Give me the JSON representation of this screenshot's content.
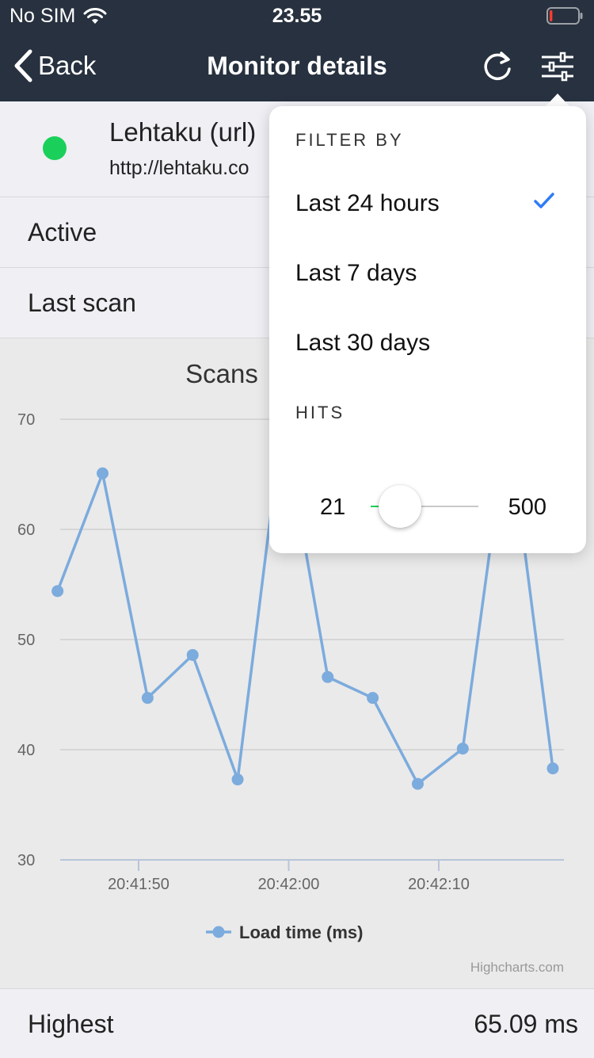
{
  "status_bar": {
    "carrier": "No SIM",
    "time": "23.55",
    "battery_level": 0.1
  },
  "nav": {
    "back_label": "Back",
    "title": "Monitor details",
    "refresh_icon": "refresh-icon",
    "filter_icon": "sliders-icon"
  },
  "monitor": {
    "name": "Lehtaku (url)",
    "url": "http://lehtaku.co",
    "status_color": "#1bd05a"
  },
  "rows": {
    "active_label": "Active",
    "last_scan_label": "Last scan"
  },
  "chart_data": {
    "type": "line",
    "title": "Scans",
    "x_ticks": [
      "20:41:50",
      "20:42:00",
      "20:42:10"
    ],
    "y_ticks": [
      30,
      40,
      50,
      60,
      70
    ],
    "ylim": [
      30,
      70
    ],
    "grid": true,
    "legend": "bottom",
    "color": "#7cabdd",
    "series": [
      {
        "name": "Load time (ms)",
        "x": [
          "20:41:44.6",
          "20:41:47.6",
          "20:41:50.6",
          "20:41:53.6",
          "20:41:56.6",
          "20:41:59.6",
          "20:42:02.6",
          "20:42:05.6",
          "20:42:08.6",
          "20:42:11.6",
          "20:42:14.6",
          "20:42:17.6"
        ],
        "values": [
          54.4,
          65.09,
          44.7,
          48.6,
          37.3,
          70,
          46.6,
          44.7,
          36.9,
          40.1,
          70,
          38.3
        ]
      }
    ],
    "credits": "Highcharts.com"
  },
  "filter_popover": {
    "filter_heading": "FILTER BY",
    "options": [
      {
        "label": "Last 24 hours",
        "selected": true
      },
      {
        "label": "Last 7 days",
        "selected": false
      },
      {
        "label": "Last 30 days",
        "selected": false
      }
    ],
    "hits_heading": "HITS",
    "slider": {
      "min_label": "21",
      "max_label": "500",
      "min": 21,
      "max": 500,
      "value": 150
    },
    "accent": "#1bd05a",
    "check_color": "#2f7cf6"
  },
  "summary": {
    "highest_label": "Highest",
    "highest_value": "65.09 ms"
  }
}
